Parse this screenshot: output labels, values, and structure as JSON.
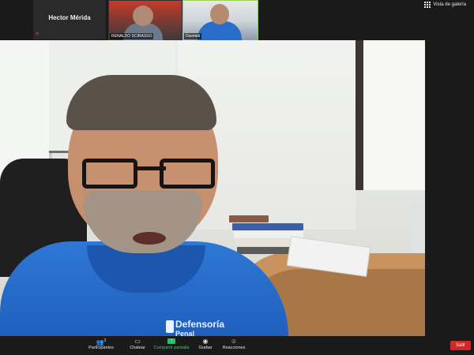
{
  "participants": {
    "tile1": {
      "name": "Hector Mérida"
    },
    "tile2": {
      "label": "RENALDO SCIRASSO"
    },
    "tile3": {
      "label": "Dsemidi"
    }
  },
  "view_button": {
    "label": "Vista de galería",
    "icon": "grid-icon"
  },
  "main_video": {
    "jacket_text_line1": "Defensoría",
    "jacket_text_line2": "Penal"
  },
  "toolbar": {
    "participants": {
      "label": "Participantes",
      "count": "2",
      "icon": "people-icon"
    },
    "chat": {
      "label": "Chatear",
      "icon": "chat-icon"
    },
    "share": {
      "label": "Compartir pantalla",
      "icon": "share-screen-icon"
    },
    "record": {
      "label": "Grabar",
      "icon": "record-icon"
    },
    "reactions": {
      "label": "Reacciones",
      "icon": "reactions-icon"
    },
    "leave": {
      "label": "Salir"
    }
  },
  "colors": {
    "share_green": "#23c45c",
    "leave_red": "#d32626",
    "active_border": "#9bcf5a"
  }
}
